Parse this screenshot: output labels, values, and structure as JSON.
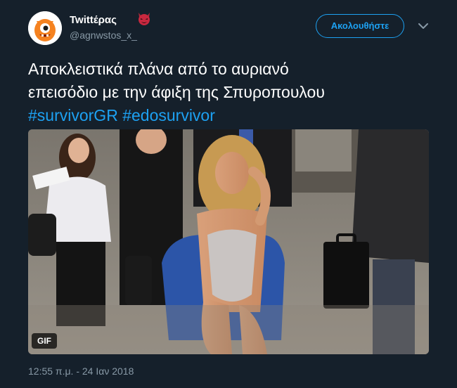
{
  "author": {
    "display_name": "Twittέρας",
    "handle": "@agnwstos_x_",
    "avatar_icon": "orange-monster-avatar-icon",
    "badge_icon": "devil-emoji-icon"
  },
  "header": {
    "follow_label": "Ακολουθήστε",
    "menu_icon": "chevron-down-icon"
  },
  "tweet": {
    "text_line_1": "Αποκλειστικά πλάνα από το αυριανό",
    "text_line_2": "επεισόδιο με την άφιξη της Σπυροπουλου",
    "hashtag_1": "#survivorGR",
    "hashtag_2": "#edosurvivor"
  },
  "media": {
    "badge": "GIF"
  },
  "meta": {
    "timestamp": "12:55 π.μ. - 24 Ιαν 2018"
  },
  "colors": {
    "background": "#15202b",
    "accent": "#1da1f2",
    "secondary_text": "#8899a6",
    "primary_text": "#ffffff"
  }
}
